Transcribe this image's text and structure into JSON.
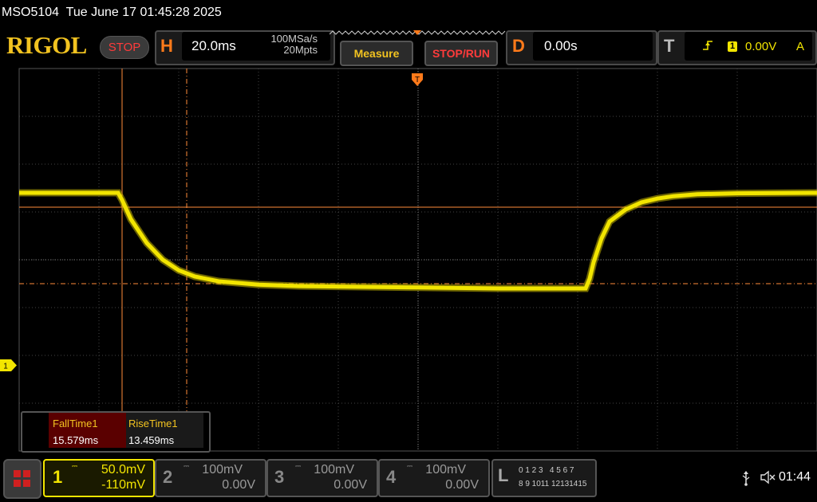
{
  "title": "MSO5104  Tue June 17 01:45:28 2025",
  "brand": "RIGOL",
  "run_state": "STOP",
  "horizontal": {
    "letter": "H",
    "scale": "20.0ms",
    "sample_rate": "100MSa/s",
    "memory_depth": "20Mpts"
  },
  "buttons": {
    "measure": "Measure",
    "stop_run": "STOP/RUN"
  },
  "delay": {
    "letter": "D",
    "value": "0.00s"
  },
  "trigger": {
    "letter": "T",
    "edge_icon": "rising-edge-icon",
    "source": "1",
    "level": "0.00V",
    "mode": "A"
  },
  "waveform_marker": "1",
  "measurements": [
    {
      "name": "FallTime1",
      "value": "15.579ms"
    },
    {
      "name": "RiseTime1",
      "value": "13.459ms"
    }
  ],
  "channels": [
    {
      "num": "1",
      "scale": "50.0mV",
      "offset": "-110mV",
      "color": "#f2e500",
      "active": true
    },
    {
      "num": "2",
      "scale": "100mV",
      "offset": "0.00V",
      "color": "#888888",
      "active": false
    },
    {
      "num": "3",
      "scale": "100mV",
      "offset": "0.00V",
      "color": "#888888",
      "active": false
    },
    {
      "num": "4",
      "scale": "100mV",
      "offset": "0.00V",
      "color": "#888888",
      "active": false
    }
  ],
  "logic": {
    "letter": "L",
    "row1": "0 1 2 3   4 5 6 7",
    "row2": "8 9 1011 12131415"
  },
  "status": {
    "usb_icon": "usb-icon",
    "speaker_icon": "speaker-muted-icon",
    "time": "01:44"
  },
  "colors": {
    "ch1": "#f2e500",
    "cursor": "#ff8c3a",
    "brand": "#f2c320",
    "stop": "#ff3b3b",
    "grid": "#444444"
  },
  "chart_data": {
    "type": "line",
    "x_unit": "divisions",
    "y_unit": "divisions",
    "xlim": [
      -5,
      5
    ],
    "ylim": [
      -4,
      4
    ],
    "series": [
      {
        "values_x": [
          -5.0,
          -3.76,
          -3.71,
          -3.6,
          -3.4,
          -3.2,
          -3.0,
          -2.8,
          -2.5,
          -2.0,
          -1.5,
          0,
          1.0,
          2.0,
          2.1,
          2.15,
          2.2,
          2.3,
          2.4,
          2.6,
          2.8,
          3.0,
          3.2,
          3.5,
          4.0,
          5.0
        ],
        "values_y": [
          1.4,
          1.4,
          1.25,
          0.85,
          0.35,
          0.0,
          -0.22,
          -0.35,
          -0.45,
          -0.52,
          -0.55,
          -0.58,
          -0.6,
          -0.6,
          -0.6,
          -0.4,
          -0.05,
          0.45,
          0.8,
          1.05,
          1.2,
          1.28,
          1.33,
          1.37,
          1.39,
          1.4
        ]
      }
    ],
    "cursors": {
      "vertical_solid": -3.71,
      "vertical_dashed": -2.9,
      "horizontal_solid": 1.1,
      "horizontal_dashed": -0.5
    },
    "trigger_x": 0
  }
}
